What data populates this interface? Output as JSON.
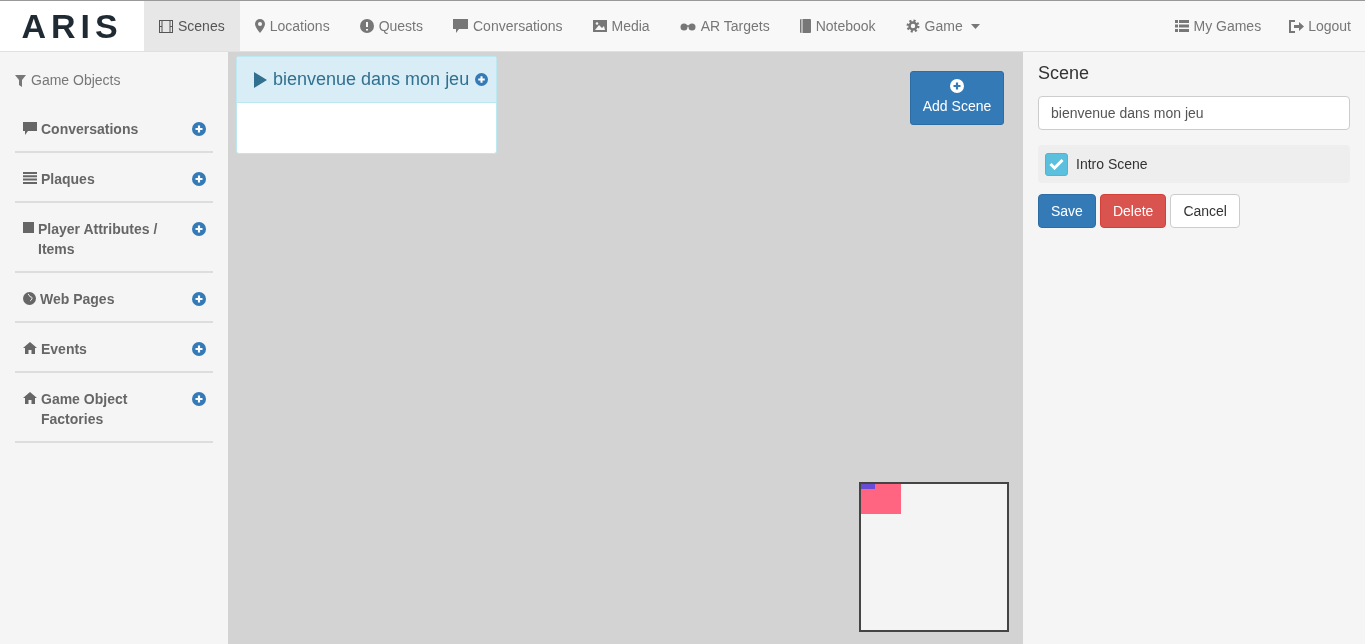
{
  "logo": "ARIS",
  "nav": [
    {
      "label": "Scenes",
      "selected": true,
      "dropdown": false
    },
    {
      "label": "Locations",
      "selected": false,
      "dropdown": false
    },
    {
      "label": "Quests",
      "selected": false,
      "dropdown": false
    },
    {
      "label": "Conversations",
      "selected": false,
      "dropdown": false
    },
    {
      "label": "Media",
      "selected": false,
      "dropdown": false
    },
    {
      "label": "AR Targets",
      "selected": false,
      "dropdown": false
    },
    {
      "label": "Notebook",
      "selected": false,
      "dropdown": false
    },
    {
      "label": "Game",
      "selected": false,
      "dropdown": true
    }
  ],
  "nav_right": [
    {
      "label": "My Games"
    },
    {
      "label": "Logout"
    }
  ],
  "sidebar": {
    "title": "Game Objects",
    "groups": [
      {
        "label": "Conversations"
      },
      {
        "label": "Plaques"
      },
      {
        "label": "Player Attributes / Items"
      },
      {
        "label": "Web Pages"
      },
      {
        "label": "Events"
      },
      {
        "label": "Game Object Factories"
      }
    ]
  },
  "scene_card": {
    "title": "bienvenue dans mon jeu"
  },
  "add_scene_button": "Add Scene",
  "panel": {
    "heading": "Scene",
    "name_value": "bienvenue dans mon jeu",
    "intro": {
      "label": "Intro Scene",
      "checked": true
    },
    "buttons": [
      {
        "label": "Save",
        "kind": "primary"
      },
      {
        "label": "Delete",
        "kind": "danger"
      },
      {
        "label": "Cancel",
        "kind": "default"
      }
    ]
  }
}
